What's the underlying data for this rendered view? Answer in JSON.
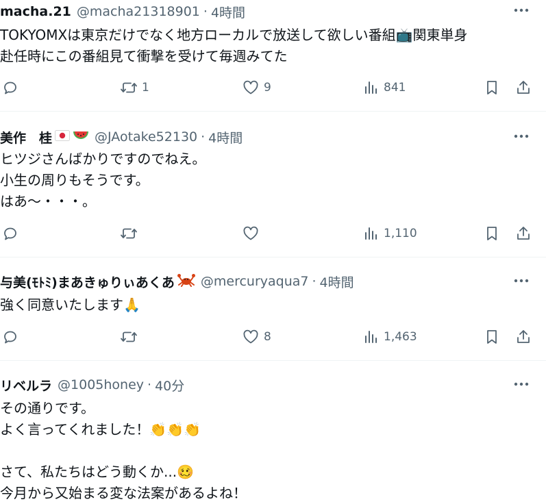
{
  "tweets": [
    {
      "name": "macha.21",
      "handle": "@macha21318901",
      "sep": "·",
      "time": "4時間",
      "text": "TOKYOMXは東京だけでなく地方ローカルで放送して欲しい番組📺関東単身\n赴任時にこの番組見て衝撃を受けて毎週みてた",
      "replies": "",
      "retweets": "1",
      "likes": "9",
      "views": "841"
    },
    {
      "name": "美作　桂",
      "name_emoji": [
        "jp-flag-icon",
        "watermelon-icon"
      ],
      "handle": "@JAotake52130",
      "sep": "·",
      "time": "4時間",
      "text": "ヒツジさんばかりですのでねえ。\n小生の周りもそうです。\nはあ～・・・。",
      "replies": "",
      "retweets": "",
      "likes": "",
      "views": "1,110"
    },
    {
      "name": "与美(ﾓﾄﾐ)まあきゅりぃあくあ",
      "name_emoji": [
        "crab-icon"
      ],
      "handle": "@mercuryaqua7",
      "sep": "·",
      "time": "4時間",
      "text": "強く同意いたします🙏",
      "replies": "",
      "retweets": "",
      "likes": "8",
      "views": "1,463"
    },
    {
      "name": "リベルラ",
      "handle": "@1005honey",
      "sep": "·",
      "time": "40分",
      "text": "その通りです。\nよく言ってくれました！👏👏👏\n\nさて、私たちはどう動くか...🥴\n今月から又始まる変な法案があるよね！"
    }
  ],
  "colors": {
    "text": "#0f1419",
    "secondary": "#536471",
    "divider": "#eff3f4"
  }
}
